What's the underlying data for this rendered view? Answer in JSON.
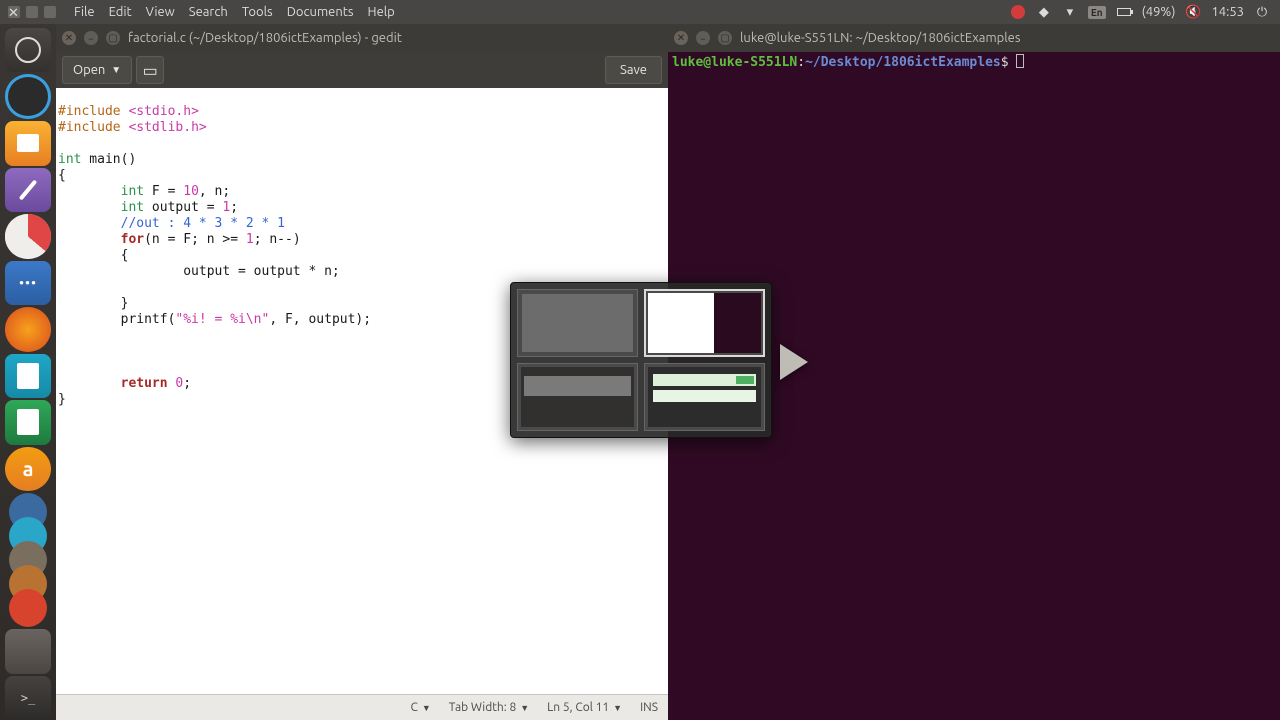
{
  "menubar": {
    "items": [
      "File",
      "Edit",
      "View",
      "Search",
      "Tools",
      "Documents",
      "Help"
    ]
  },
  "systray": {
    "lang": "En",
    "battery": "(49%)",
    "time": "14:53"
  },
  "gedit": {
    "title": "factorial.c  (~/Desktop/1806ictExamples) - gedit",
    "open_label": "Open",
    "save_label": "Save",
    "status": {
      "lang": "C",
      "tabwidth": "Tab Width: 8",
      "cursor": "Ln 5, Col 11",
      "ins": "INS"
    },
    "code": {
      "l1_a": "#include ",
      "l1_b": "<stdio.h>",
      "l2_a": "#include ",
      "l2_b": "<stdlib.h>",
      "l3": "",
      "l4_a": "int",
      "l4_b": " main()",
      "l5": "{",
      "l6_a": "        ",
      "l6_b": "int",
      "l6_c": " F = ",
      "l6_d": "10",
      "l6_e": ", n;",
      "l7_a": "        ",
      "l7_b": "int",
      "l7_c": " output = ",
      "l7_d": "1",
      "l7_e": ";",
      "l8_a": "        ",
      "l8_b": "//out : 4 * 3 * 2 * 1",
      "l9_a": "        ",
      "l9_b": "for",
      "l9_c": "(n = F; n >= ",
      "l9_d": "1",
      "l9_e": "; n--)",
      "l10": "        {",
      "l11": "                output = output * n;",
      "l12": "",
      "l13": "        }",
      "l14_a": "        printf(",
      "l14_b": "\"%i! = %i\\n\"",
      "l14_c": ", F, output);",
      "l15": "",
      "l16": "",
      "l17": "",
      "l18_a": "        ",
      "l18_b": "return",
      "l18_c": " ",
      "l18_d": "0",
      "l18_e": ";",
      "l19": "}"
    }
  },
  "terminal": {
    "title": "luke@luke-S551LN: ~/Desktop/1806ictExamples",
    "prompt_user": "luke@luke-S551LN",
    "prompt_colon": ":",
    "prompt_path": "~/Desktop/1806ictExamples",
    "prompt_dollar": "$ "
  }
}
